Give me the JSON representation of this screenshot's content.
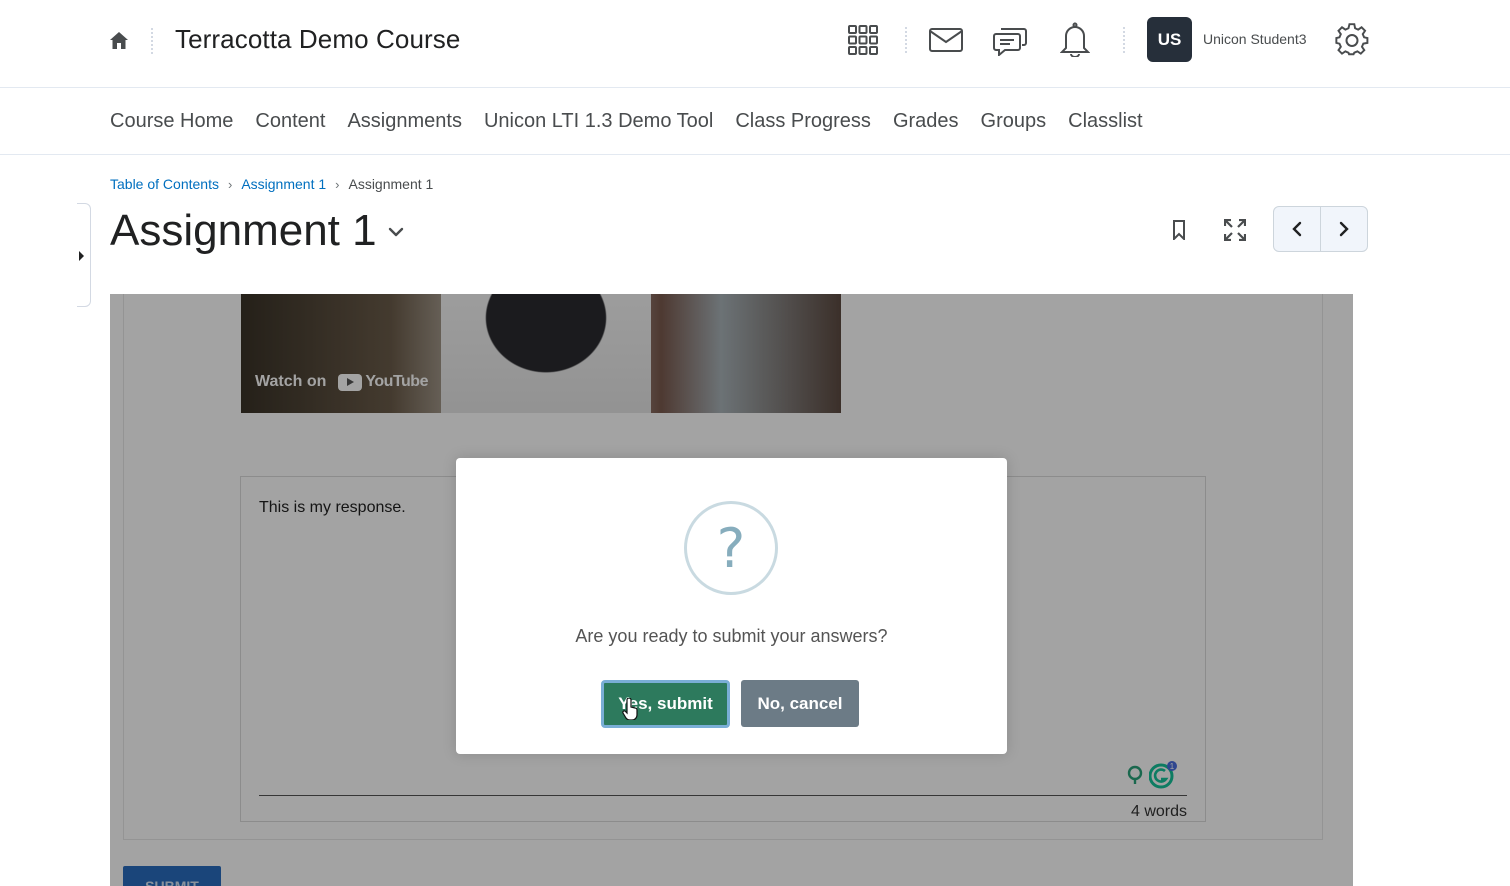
{
  "header": {
    "course_title": "Terracotta Demo Course",
    "user_initials": "US",
    "user_name": "Unicon Student3"
  },
  "nav": {
    "items": [
      "Course Home",
      "Content",
      "Assignments",
      "Unicon LTI 1.3 Demo Tool",
      "Class Progress",
      "Grades",
      "Groups",
      "Classlist"
    ]
  },
  "breadcrumbs": {
    "items": [
      "Table of Contents",
      "Assignment 1"
    ],
    "current": "Assignment 1"
  },
  "page": {
    "title": "Assignment 1"
  },
  "content": {
    "video_watch_label": "Watch on",
    "video_brand": "YouTube",
    "response_text": "This is my response.",
    "word_count": "4 words",
    "grammarly_badge": "1",
    "submit_label": "SUBMIT"
  },
  "modal": {
    "icon_symbol": "?",
    "message": "Are you ready to submit your answers?",
    "confirm_label": "Yes, submit",
    "cancel_label": "No, cancel"
  },
  "colors": {
    "confirm": "#2d7a5d",
    "cancel": "#6c7b86",
    "link": "#006fbf",
    "avatar": "#262f3a"
  }
}
